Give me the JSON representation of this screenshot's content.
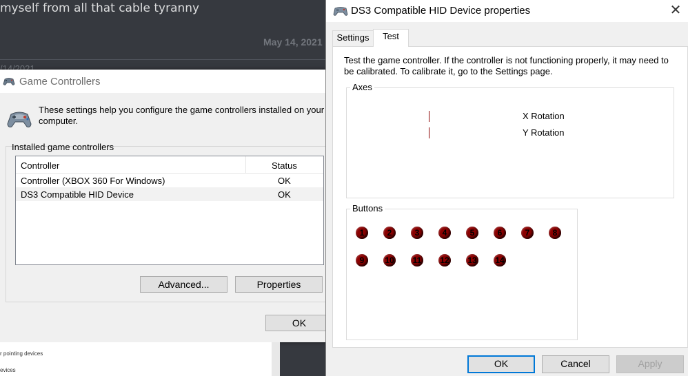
{
  "chat": {
    "message": "myself from all that cable tyranny",
    "date": "May 14, 2021",
    "date_partial": "/14/2021"
  },
  "game_controllers": {
    "title": "Game Controllers",
    "info_text": "These settings help you configure the game controllers installed on your computer.",
    "group_label": "Installed game controllers",
    "columns": {
      "controller": "Controller",
      "status": "Status"
    },
    "rows": [
      {
        "controller": "Controller (XBOX 360 For Windows)",
        "status": "OK"
      },
      {
        "controller": "DS3 Compatible HID Device",
        "status": "OK"
      }
    ],
    "buttons": {
      "advanced": "Advanced...",
      "properties": "Properties",
      "ok": "OK"
    }
  },
  "device_manager": {
    "line1": "r pointing devices",
    "line2": "evices"
  },
  "ds3_properties": {
    "title": "DS3 Compatible HID Device properties",
    "close_glyph": "✕",
    "tabs": {
      "settings": "Settings",
      "test": "Test"
    },
    "description": "Test the game controller.  If the controller is not functioning properly, it may need to be calibrated.  To calibrate it, go to the Settings page.",
    "axes": {
      "label": "Axes",
      "x_rotation": "X Rotation",
      "y_rotation": "Y Rotation"
    },
    "buttons_group": {
      "label": "Buttons",
      "numbers": [
        "1",
        "2",
        "3",
        "4",
        "5",
        "6",
        "7",
        "8",
        "9",
        "10",
        "11",
        "12",
        "13",
        "14"
      ]
    },
    "footer": {
      "ok": "OK",
      "cancel": "Cancel",
      "apply": "Apply"
    }
  },
  "colors": {
    "chat_bg": "#36393f",
    "button_indicator": "#8b0000",
    "focus_border": "#0078d7"
  }
}
